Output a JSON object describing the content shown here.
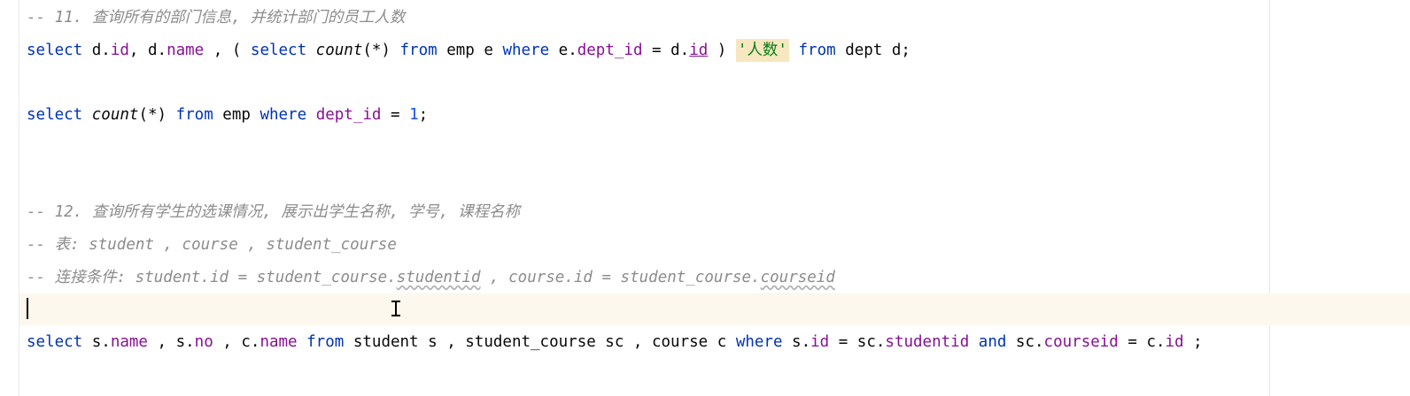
{
  "editor": {
    "lines": {
      "c11": "-- 11. 查询所有的部门信息, 并统计部门的员工人数",
      "q1": {
        "t1": "select",
        "t2": " d.",
        "t3": "id",
        "t4": ", d.",
        "t5": "name",
        "t6": " , ( ",
        "t7": "select",
        "t8": " ",
        "t9": "count",
        "t10": "(*) ",
        "t11": "from",
        "t12": " emp e ",
        "t13": "where",
        "t14": " e.",
        "t15": "dept_id",
        "t16": " = d.",
        "t17": "id",
        "t18": " ) ",
        "t19": "'人数'",
        "t20": " ",
        "t21": "from",
        "t22": " dept d;"
      },
      "q2": {
        "t1": "select",
        "t2": " ",
        "t3": "count",
        "t4": "(*) ",
        "t5": "from",
        "t6": " emp ",
        "t7": "where",
        "t8": " ",
        "t9": "dept_id",
        "t10": " = ",
        "t11": "1",
        "t12": ";"
      },
      "c12": "-- 12. 查询所有学生的选课情况, 展示出学生名称, 学号, 课程名称",
      "c_tables": "-- 表: student , course , student_course",
      "c_join": {
        "a": "-- 连接条件: student.id = student_course.",
        "b": "studentid",
        "c": " , course.id = student_course.",
        "d": "courseid"
      },
      "q3": {
        "t1": "select",
        "t2": " s.",
        "t3": "name",
        "t4": " , s.",
        "t5": "no",
        "t6": " , c.",
        "t7": "name",
        "t8": " ",
        "t9": "from",
        "t10": " student s , student_course sc , course c ",
        "t11": "where",
        "t12": " s.",
        "t13": "id",
        "t14": " = sc.",
        "t15": "studentid",
        "t16": " ",
        "t17": "and",
        "t18": " sc.",
        "t19": "courseid",
        "t20": " = c.",
        "t21": "id",
        "t22": " ;"
      }
    }
  }
}
